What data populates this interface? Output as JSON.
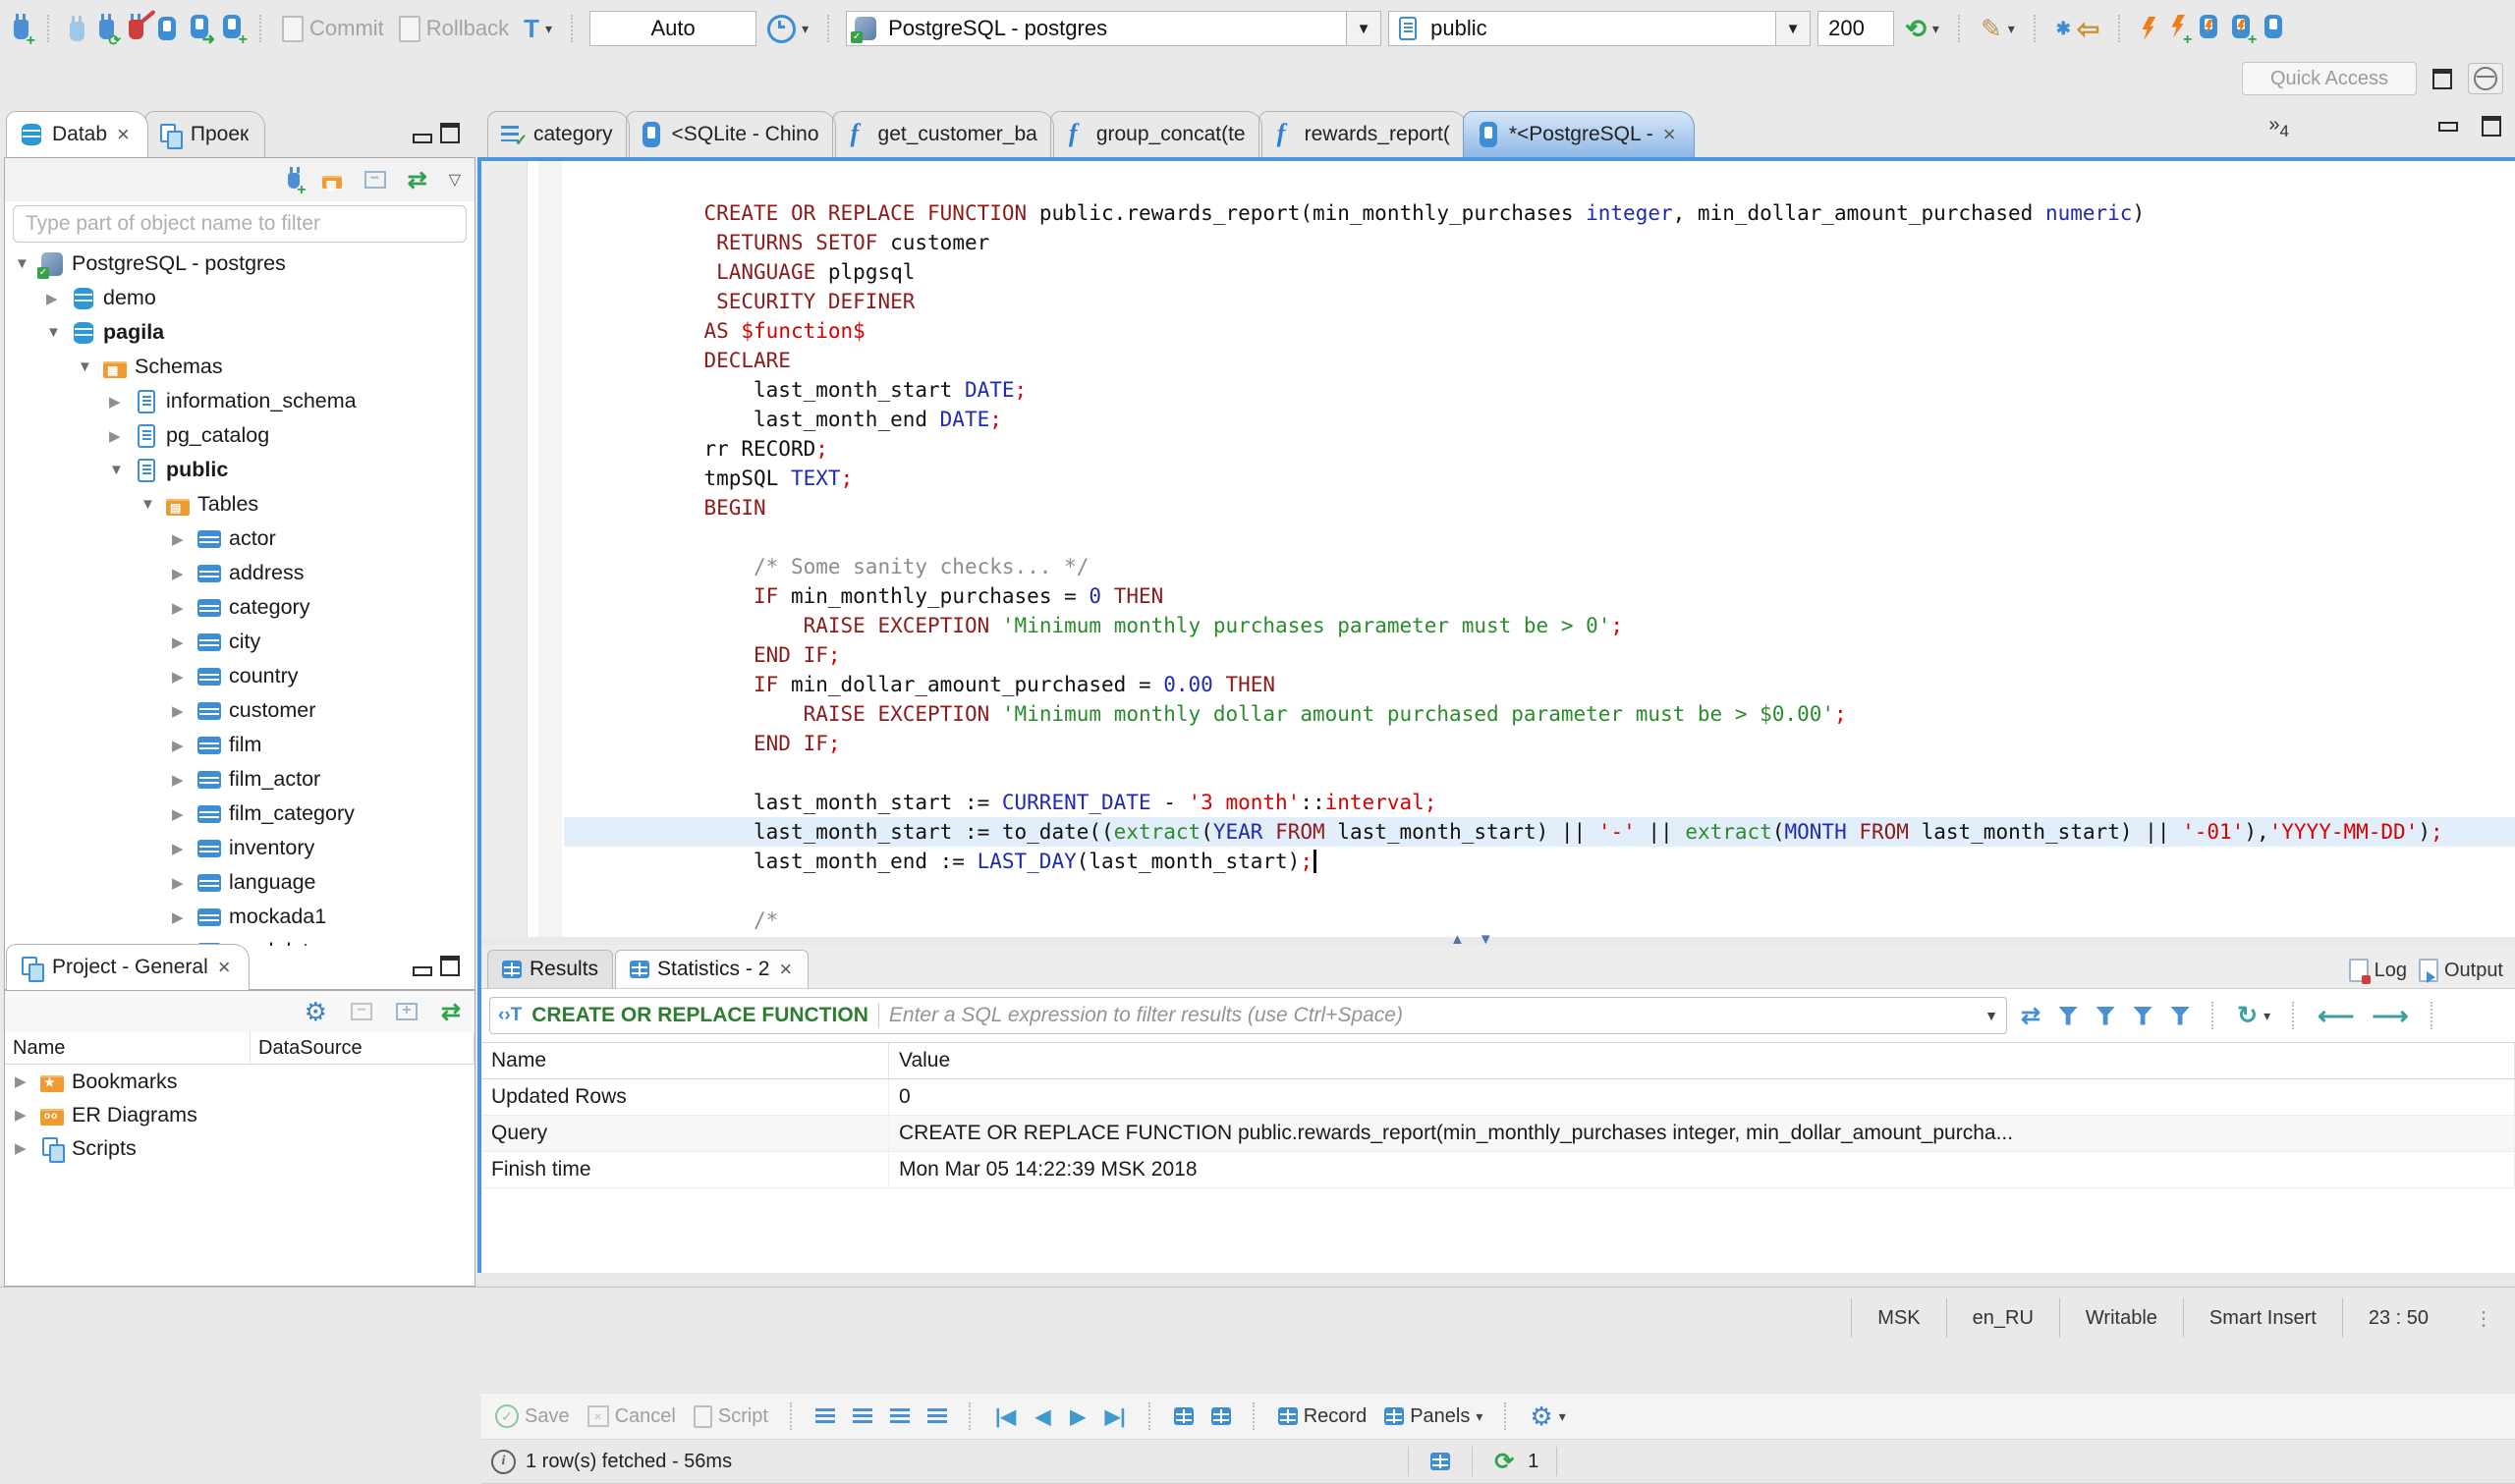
{
  "toolbar": {
    "commit": "Commit",
    "rollback": "Rollback",
    "auto": "Auto",
    "connection": "PostgreSQL - postgres",
    "schema": "public",
    "fetch_size": "200",
    "quick_access": "Quick Access"
  },
  "left": {
    "tabs": [
      {
        "label": "Datab",
        "active": 1,
        "close": 1,
        "icon": "db"
      },
      {
        "label": "Проек",
        "icon": "scripts"
      }
    ],
    "filter_placeholder": "Type part of object name to filter",
    "tree": [
      {
        "label": "PostgreSQL - postgres",
        "level": 0,
        "open": 1,
        "icon": "pg"
      },
      {
        "label": "demo",
        "level": 1,
        "icon": "db2"
      },
      {
        "label": "pagila",
        "level": 1,
        "open": 1,
        "icon": "db",
        "bold": 1
      },
      {
        "label": "Schemas",
        "level": 2,
        "open": 1,
        "icon": "folder-grid"
      },
      {
        "label": "information_schema",
        "level": 3,
        "icon": "schema"
      },
      {
        "label": "pg_catalog",
        "level": 3,
        "icon": "schema"
      },
      {
        "label": "public",
        "level": 3,
        "open": 1,
        "icon": "schema",
        "bold": 1
      },
      {
        "label": "Tables",
        "level": 4,
        "open": 1,
        "icon": "folder-table"
      },
      {
        "label": "actor",
        "level": 5,
        "icon": "table"
      },
      {
        "label": "address",
        "level": 5,
        "icon": "table"
      },
      {
        "label": "category",
        "level": 5,
        "icon": "table"
      },
      {
        "label": "city",
        "level": 5,
        "icon": "table"
      },
      {
        "label": "country",
        "level": 5,
        "icon": "table"
      },
      {
        "label": "customer",
        "level": 5,
        "icon": "table"
      },
      {
        "label": "film",
        "level": 5,
        "icon": "table"
      },
      {
        "label": "film_actor",
        "level": 5,
        "icon": "table"
      },
      {
        "label": "film_category",
        "level": 5,
        "icon": "table"
      },
      {
        "label": "inventory",
        "level": 5,
        "icon": "table"
      },
      {
        "label": "language",
        "level": 5,
        "icon": "table"
      },
      {
        "label": "mockada1",
        "level": 5,
        "icon": "table"
      },
      {
        "label": "mockdata",
        "level": 5,
        "icon": "table"
      }
    ],
    "project": {
      "title": "Project - General",
      "columns": [
        "Name",
        "DataSource"
      ],
      "items": [
        {
          "label": "Bookmarks",
          "icon": "folder-star"
        },
        {
          "label": "ER Diagrams",
          "icon": "folder-er"
        },
        {
          "label": "Scripts",
          "icon": "scripts"
        }
      ]
    }
  },
  "editor": {
    "tabs": [
      {
        "label": "category",
        "icon": "grid-check"
      },
      {
        "label": "<SQLite - Chino",
        "icon": "sql"
      },
      {
        "label": "get_customer_ba",
        "icon": "fn"
      },
      {
        "label": "group_concat(te",
        "icon": "fn"
      },
      {
        "label": "rewards_report(",
        "icon": "fn"
      },
      {
        "label": "*<PostgreSQL - ",
        "icon": "sql",
        "active": 1,
        "close": 1
      }
    ],
    "overflow_count": "4",
    "code": [
      {
        "s": [
          {
            "t": "CREATE OR REPLACE FUNCTION",
            "c": "k"
          },
          {
            "t": " public.rewards_report(min_monthly_purchases ",
            "c": "p"
          },
          {
            "t": "integer",
            "c": "b"
          },
          {
            "t": ", min_dollar_amount_purchased ",
            "c": "p"
          },
          {
            "t": "numeric",
            "c": "b"
          },
          {
            "t": ")",
            "c": "p"
          }
        ]
      },
      {
        "s": [
          {
            "t": " ",
            "c": "p"
          },
          {
            "t": "RETURNS SETOF",
            "c": "k"
          },
          {
            "t": " customer",
            "c": "p"
          }
        ]
      },
      {
        "s": [
          {
            "t": " ",
            "c": "p"
          },
          {
            "t": "LANGUAGE",
            "c": "k"
          },
          {
            "t": " plpgsql",
            "c": "p"
          }
        ]
      },
      {
        "s": [
          {
            "t": " ",
            "c": "p"
          },
          {
            "t": "SECURITY DEFINER",
            "c": "k"
          }
        ]
      },
      {
        "s": [
          {
            "t": "AS",
            "c": "k"
          },
          {
            "t": " ",
            "c": "p"
          },
          {
            "t": "$function$",
            "c": "r"
          }
        ]
      },
      {
        "s": [
          {
            "t": "DECLARE",
            "c": "k"
          }
        ]
      },
      {
        "s": [
          {
            "t": "    last_month_start ",
            "c": "p"
          },
          {
            "t": "DATE",
            "c": "b"
          },
          {
            "t": ";",
            "c": "r"
          }
        ]
      },
      {
        "s": [
          {
            "t": "    last_month_end ",
            "c": "p"
          },
          {
            "t": "DATE",
            "c": "b"
          },
          {
            "t": ";",
            "c": "r"
          }
        ]
      },
      {
        "s": [
          {
            "t": "rr RECORD",
            "c": "p"
          },
          {
            "t": ";",
            "c": "r"
          }
        ]
      },
      {
        "s": [
          {
            "t": "tmpSQL ",
            "c": "p"
          },
          {
            "t": "TEXT",
            "c": "b"
          },
          {
            "t": ";",
            "c": "r"
          }
        ]
      },
      {
        "s": [
          {
            "t": "BEGIN",
            "c": "k"
          }
        ]
      },
      {
        "s": []
      },
      {
        "s": [
          {
            "t": "    /* Some sanity checks... */",
            "c": "c"
          }
        ]
      },
      {
        "s": [
          {
            "t": "    ",
            "c": "p"
          },
          {
            "t": "IF",
            "c": "k"
          },
          {
            "t": " min_monthly_purchases = ",
            "c": "p"
          },
          {
            "t": "0",
            "c": "b"
          },
          {
            "t": " ",
            "c": "p"
          },
          {
            "t": "THEN",
            "c": "k"
          }
        ]
      },
      {
        "s": [
          {
            "t": "        ",
            "c": "p"
          },
          {
            "t": "RAISE EXCEPTION",
            "c": "k"
          },
          {
            "t": " ",
            "c": "p"
          },
          {
            "t": "'Minimum monthly purchases parameter must be > 0'",
            "c": "s"
          },
          {
            "t": ";",
            "c": "r"
          }
        ]
      },
      {
        "s": [
          {
            "t": "    ",
            "c": "p"
          },
          {
            "t": "END IF",
            "c": "k"
          },
          {
            "t": ";",
            "c": "r"
          }
        ]
      },
      {
        "s": [
          {
            "t": "    ",
            "c": "p"
          },
          {
            "t": "IF",
            "c": "k"
          },
          {
            "t": " min_dollar_amount_purchased = ",
            "c": "p"
          },
          {
            "t": "0.00",
            "c": "b"
          },
          {
            "t": " ",
            "c": "p"
          },
          {
            "t": "THEN",
            "c": "k"
          }
        ]
      },
      {
        "s": [
          {
            "t": "        ",
            "c": "p"
          },
          {
            "t": "RAISE EXCEPTION",
            "c": "k"
          },
          {
            "t": " ",
            "c": "p"
          },
          {
            "t": "'Minimum monthly dollar amount purchased parameter must be > $0.00'",
            "c": "s"
          },
          {
            "t": ";",
            "c": "r"
          }
        ]
      },
      {
        "s": [
          {
            "t": "    ",
            "c": "p"
          },
          {
            "t": "END IF",
            "c": "k"
          },
          {
            "t": ";",
            "c": "r"
          }
        ]
      },
      {
        "s": []
      },
      {
        "s": [
          {
            "t": "    last_month_start := ",
            "c": "p"
          },
          {
            "t": "CURRENT_DATE",
            "c": "b"
          },
          {
            "t": " - ",
            "c": "p"
          },
          {
            "t": "'3 month'",
            "c": "r"
          },
          {
            "t": "::",
            "c": "p"
          },
          {
            "t": "interval",
            "c": "r"
          },
          {
            "t": ";",
            "c": "r"
          }
        ]
      },
      {
        "s": [
          {
            "t": "    last_month_start := to_date((",
            "c": "p"
          },
          {
            "t": "extract",
            "c": "s"
          },
          {
            "t": "(",
            "c": "p"
          },
          {
            "t": "YEAR",
            "c": "b"
          },
          {
            "t": " ",
            "c": "p"
          },
          {
            "t": "FROM",
            "c": "k"
          },
          {
            "t": " last_month_start) || ",
            "c": "p"
          },
          {
            "t": "'-'",
            "c": "r"
          },
          {
            "t": " || ",
            "c": "p"
          },
          {
            "t": "extract",
            "c": "s"
          },
          {
            "t": "(",
            "c": "p"
          },
          {
            "t": "MONTH",
            "c": "b"
          },
          {
            "t": " ",
            "c": "p"
          },
          {
            "t": "FROM",
            "c": "k"
          },
          {
            "t": " last_month_start) || ",
            "c": "p"
          },
          {
            "t": "'-01'",
            "c": "r"
          },
          {
            "t": "),",
            "c": "p"
          },
          {
            "t": "'YYYY-MM-DD'",
            "c": "r"
          },
          {
            "t": ")",
            "c": "p"
          },
          {
            "t": ";",
            "c": "r"
          }
        ]
      },
      {
        "h": 1,
        "u": 1,
        "s": [
          {
            "t": "    last_month_end := ",
            "c": "p"
          },
          {
            "t": "LAST_DAY",
            "c": "b"
          },
          {
            "t": "(last_month_start)",
            "c": "p"
          },
          {
            "t": ";",
            "c": "r"
          }
        ]
      },
      {
        "s": []
      },
      {
        "s": [
          {
            "t": "    /*",
            "c": "c"
          }
        ]
      }
    ]
  },
  "results": {
    "tabs": [
      {
        "label": "Results"
      },
      {
        "label": "Statistics - 2",
        "active": 1,
        "close": 1
      }
    ],
    "log_label": "Log",
    "output_label": "Output",
    "filter_prefix": "CREATE OR REPLACE FUNCTION",
    "filter_placeholder": "Enter a SQL expression to filter results (use Ctrl+Space)",
    "columns": [
      "Name",
      "Value"
    ],
    "rows": [
      {
        "name": "Updated Rows",
        "value": "0"
      },
      {
        "name": "Query",
        "value": "CREATE OR REPLACE FUNCTION public.rewards_report(min_monthly_purchases integer, min_dollar_amount_purcha..."
      },
      {
        "name": "Finish time",
        "value": "Mon Mar 05 14:22:39 MSK 2018"
      }
    ],
    "toolbar": {
      "save": "Save",
      "cancel": "Cancel",
      "script": "Script",
      "record": "Record",
      "panels": "Panels"
    },
    "status": "1 row(s) fetched - 56ms",
    "refresh_count": "1"
  },
  "statusbar": {
    "items": [
      "MSK",
      "en_RU",
      "Writable",
      "Smart Insert",
      "23 : 50"
    ]
  }
}
